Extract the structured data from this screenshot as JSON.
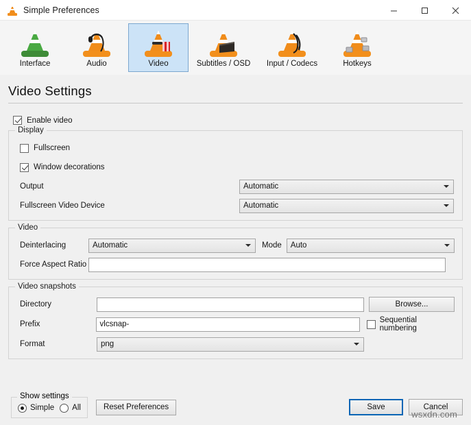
{
  "window": {
    "title": "Simple Preferences",
    "app_icon": "vlc-cone-icon",
    "controls": {
      "minimize": "minimize-icon",
      "maximize": "maximize-icon",
      "close": "close-icon"
    }
  },
  "toolbar": {
    "items": [
      {
        "label": "Interface",
        "icon": "vlc-cone-interface-icon",
        "selected": false
      },
      {
        "label": "Audio",
        "icon": "vlc-cone-audio-icon",
        "selected": false
      },
      {
        "label": "Video",
        "icon": "vlc-cone-video-icon",
        "selected": true
      },
      {
        "label": "Subtitles / OSD",
        "icon": "vlc-cone-subtitles-icon",
        "selected": false
      },
      {
        "label": "Input / Codecs",
        "icon": "vlc-cone-input-icon",
        "selected": false
      },
      {
        "label": "Hotkeys",
        "icon": "vlc-cone-hotkeys-icon",
        "selected": false
      }
    ]
  },
  "page": {
    "title": "Video Settings"
  },
  "enable_video": {
    "label": "Enable video",
    "checked": true
  },
  "display": {
    "legend": "Display",
    "fullscreen": {
      "label": "Fullscreen",
      "checked": false
    },
    "window_decorations": {
      "label": "Window decorations",
      "checked": true
    },
    "output": {
      "label": "Output",
      "value": "Automatic"
    },
    "fullscreen_video_device": {
      "label": "Fullscreen Video Device",
      "value": "Automatic"
    }
  },
  "video": {
    "legend": "Video",
    "deinterlacing": {
      "label": "Deinterlacing",
      "value": "Automatic"
    },
    "mode": {
      "label": "Mode",
      "value": "Auto"
    },
    "force_aspect_ratio": {
      "label": "Force Aspect Ratio",
      "value": "",
      "placeholder": ""
    }
  },
  "snapshots": {
    "legend": "Video snapshots",
    "directory": {
      "label": "Directory",
      "value": "",
      "placeholder": ""
    },
    "browse": {
      "label": "Browse..."
    },
    "prefix": {
      "label": "Prefix",
      "value": "vlcsnap-"
    },
    "sequential_numbering": {
      "label": "Sequential numbering",
      "checked": false
    },
    "format": {
      "label": "Format",
      "value": "png"
    }
  },
  "footer": {
    "show_settings": {
      "legend": "Show settings",
      "simple": {
        "label": "Simple",
        "selected": true
      },
      "all": {
        "label": "All",
        "selected": false
      }
    },
    "reset": {
      "label": "Reset Preferences"
    },
    "save": {
      "label": "Save"
    },
    "cancel": {
      "label": "Cancel"
    },
    "watermark": "wsxdn.com"
  },
  "colors": {
    "selection": "#cce3f7",
    "selection_border": "#7ca7cf",
    "default_button_border": "#0a65b5",
    "window_bg": "#f0f0f0"
  }
}
